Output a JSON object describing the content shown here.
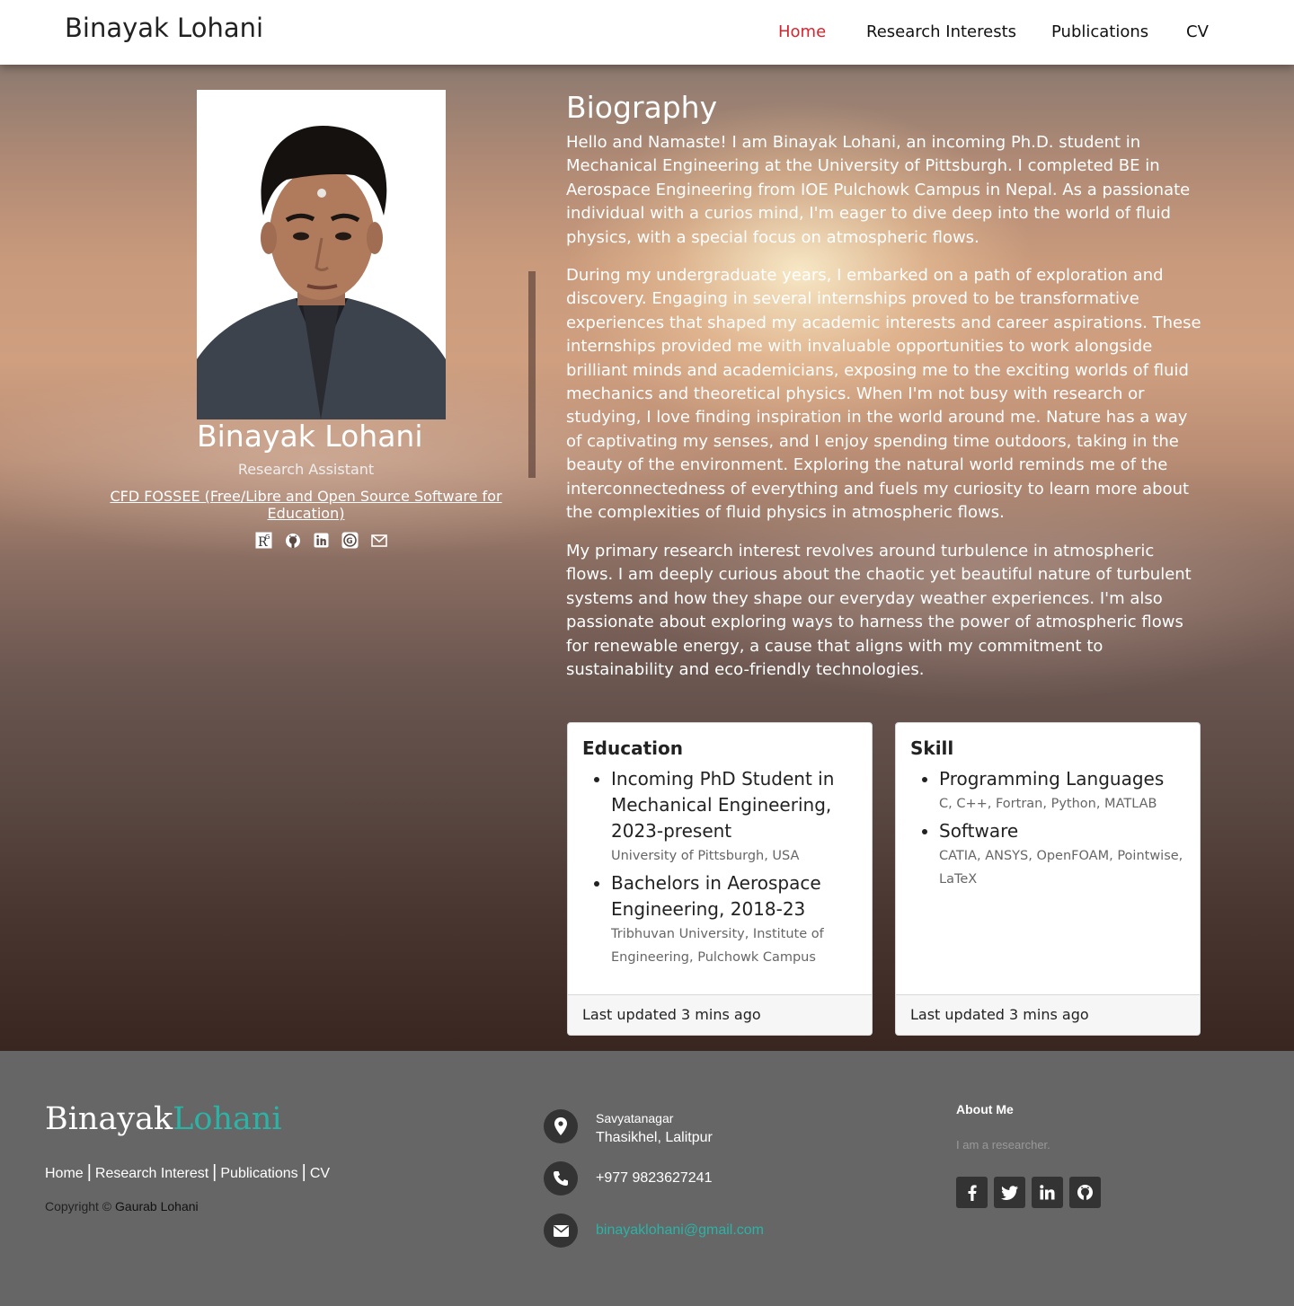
{
  "navbar": {
    "brand": "Binayak Lohani",
    "links": [
      "Home",
      "Research Interests",
      "Publications",
      "CV"
    ],
    "active_color": "#d9232d"
  },
  "profile": {
    "name": "Binayak Lohani",
    "role": "Research Assistant",
    "organization": "CFD FOSSEE (Free/Libre and Open Source Software for Education)",
    "social_icons": [
      "researchgate-icon",
      "github-icon",
      "linkedin-icon",
      "google-scholar-icon",
      "email-icon"
    ]
  },
  "biography": {
    "title": "Biography",
    "paragraphs": [
      "Hello and Namaste! I am Binayak Lohani, an incoming Ph.D. student in Mechanical Engineering at the University of Pittsburgh. I completed BE in Aerospace Engineering from IOE Pulchowk Campus in Nepal. As a passionate individual with a curios mind, I'm eager to dive deep into the world of fluid physics, with a special focus on atmospheric flows.",
      "During my undergraduate years, I embarked on a path of exploration and discovery. Engaging in several internships proved to be transformative experiences that shaped my academic interests and career aspirations. These internships provided me with invaluable opportunities to work alongside brilliant minds and academicians, exposing me to the exciting worlds of fluid mechanics and theoretical physics. When I'm not busy with research or studying, I love finding inspiration in the world around me. Nature has a way of captivating my senses, and I enjoy spending time outdoors, taking in the beauty of the environment. Exploring the natural world reminds me of the interconnectedness of everything and fuels my curiosity to learn more about the complexities of fluid physics in atmospheric flows.",
      "My primary research interest revolves around turbulence in atmospheric flows. I am deeply curious about the chaotic yet beautiful nature of turbulent systems and how they shape our everyday weather experiences. I'm also passionate about exploring ways to harness the power of atmospheric flows for renewable energy, a cause that aligns with my commitment to sustainability and eco-friendly technologies."
    ]
  },
  "education": {
    "title": "Education",
    "items": [
      {
        "heading": "Incoming PhD Student in Mechanical Engineering, 2023-present",
        "sub": "University of Pittsburgh, USA"
      },
      {
        "heading": "Bachelors in Aerospace Engineering, 2018-23",
        "sub": "Tribhuvan University, Institute of Engineering, Pulchowk Campus"
      }
    ],
    "footer": "Last updated 3 mins ago"
  },
  "skill": {
    "title": "Skill",
    "items": [
      {
        "heading": "Programming Languages",
        "sub": "C, C++, Fortran, Python, MATLAB"
      },
      {
        "heading": "Software",
        "sub": "CATIA, ANSYS, OpenFOAM, Pointwise, LaTeX"
      }
    ],
    "footer": "Last updated 3 mins ago"
  },
  "footer": {
    "brand_first": "Binayak",
    "brand_second": "Lohani",
    "brand_accent_color": "#2bb3a6",
    "links": [
      "Home",
      "Research Interest",
      "Publications",
      "CV"
    ],
    "separator": "|",
    "copyright_prefix": "Copyright ©",
    "copyright_owner": "Gaurab Lohani",
    "address_line1": "Savyatanagar",
    "address_line2": "Thasikhel, Lalitpur",
    "phone": "+977 9823627241",
    "email": "binayaklohani@gmail.com",
    "about_title": "About Me",
    "about_text": "I am a researcher.",
    "social_icons": [
      "facebook-icon",
      "twitter-icon",
      "linkedin-icon",
      "github-icon"
    ]
  }
}
